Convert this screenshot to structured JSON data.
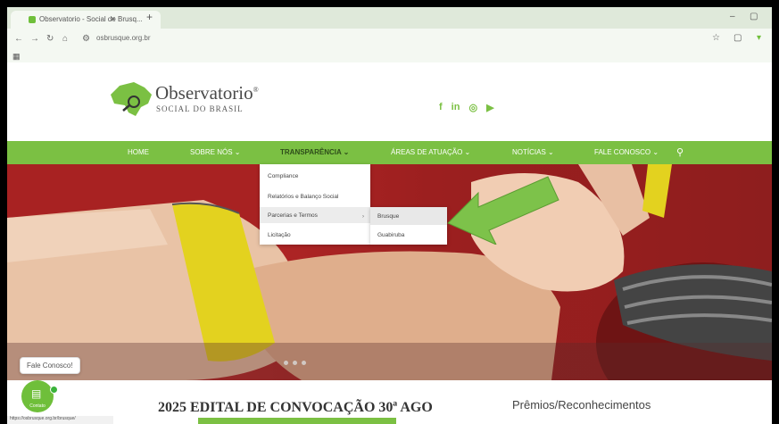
{
  "browser": {
    "tab_title": "Observatorio - Social de Brusq...",
    "tab_close": "×",
    "new_tab": "+",
    "url": "osbrusque.org.br",
    "minimize": "–",
    "restore": "▢",
    "more": "⋮"
  },
  "site": {
    "logo_title": "Observatorio",
    "logo_reg": "®",
    "logo_subtitle": "SOCIAL DO BRASIL",
    "social": [
      "f",
      "in",
      "◎",
      "▶"
    ]
  },
  "nav": {
    "items": [
      "HOME",
      "SOBRE NÓS ⌄",
      "TRANSPARÊNCIA ⌄",
      "ÁREAS DE ATUAÇÃO ⌄",
      "NOTÍCIAS ⌄",
      "FALE CONOSCO ⌄"
    ],
    "search": "⚲"
  },
  "dropdown": {
    "items": [
      "Compliance",
      "Relatórios e Balanço Social",
      "Parcerias e Termos",
      "Licitação"
    ],
    "submenu_arrow": "›",
    "submenu": [
      "Brusque",
      "Guabiruba"
    ]
  },
  "content": {
    "edital_title": "2025 EDITAL DE CONVOCAÇÃO 30ª AGO",
    "premios_title": "Prêmios/Reconhecimentos"
  },
  "chat": {
    "bubble": "Fale Conosco!",
    "button_label": "Contato"
  },
  "status": {
    "text": "https://osbrusque.org.br/brusque/"
  },
  "colors": {
    "brand_green": "#7bc043",
    "arrow_green": "#7dc24a"
  }
}
